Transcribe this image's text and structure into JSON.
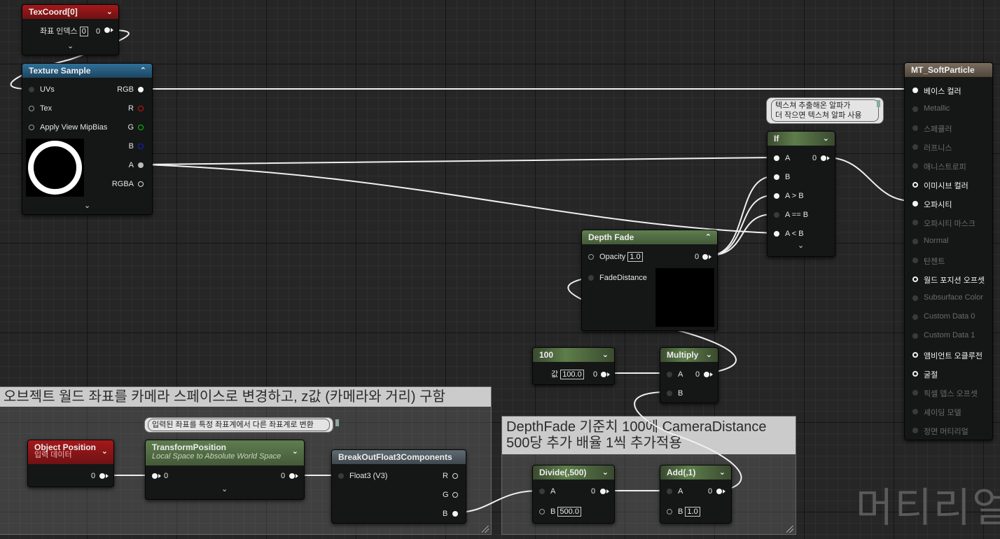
{
  "comments": {
    "c1": "오브젝트 월드 좌표를 카메라 스페이스로 변경하고, z값 (카메라와 거리) 구함",
    "c2_line1": "DepthFade 기준치 100에 CameraDistance",
    "c2_line2": "500당 추가 배율 1씩 추가적용"
  },
  "bubbles": {
    "transform": "입력된 좌표를 특정 좌표계에서 다른 좌표계로 변환",
    "if_line1": "텍스쳐 추출해온 알파가",
    "if_line2": "더 작으면 텍스쳐 알파 사용"
  },
  "nodes": {
    "texcoord": {
      "title": "TexCoord[0]",
      "param_label": "좌표 인덱스",
      "param_value": "0",
      "out": "0"
    },
    "texsample": {
      "title": "Texture Sample",
      "inputs": [
        "UVs",
        "Tex",
        "Apply View MipBias"
      ],
      "outputs": [
        "RGB",
        "R",
        "G",
        "B",
        "A",
        "RGBA"
      ]
    },
    "ifnode": {
      "title": "If",
      "out": "0",
      "inputs": [
        "A",
        "B",
        "A > B",
        "A == B",
        "A < B"
      ]
    },
    "depthfade": {
      "title": "Depth Fade",
      "opacity_label": "Opacity",
      "opacity_value": "1.0",
      "fadedist_label": "FadeDistance",
      "out": "0"
    },
    "const100": {
      "title": "100",
      "label": "값",
      "value": "100.0",
      "out": "0"
    },
    "multiply": {
      "title": "Multiply",
      "a": "A",
      "b": "B",
      "out": "0"
    },
    "objpos": {
      "title": "Object Position",
      "subtitle": "입력 데이터",
      "out": "0"
    },
    "transform": {
      "title": "TransformPosition",
      "subtitle": "Local Space to Absolute World Space",
      "in": "0",
      "out": "0"
    },
    "breakout": {
      "title": "BreakOutFloat3Components",
      "in": "Float3 (V3)",
      "outputs": [
        "R",
        "G",
        "B"
      ]
    },
    "divide": {
      "title": "Divide(,500)",
      "a": "A",
      "b": "B",
      "b_value": "500.0",
      "out": "0"
    },
    "add": {
      "title": "Add(,1)",
      "a": "A",
      "b": "B",
      "b_value": "1.0",
      "out": "0"
    }
  },
  "result": {
    "title": "MT_SoftParticle",
    "pins": [
      {
        "label": "베이스 컬러",
        "active": true
      },
      {
        "label": "Metallic",
        "active": false
      },
      {
        "label": "스페큘러",
        "active": false
      },
      {
        "label": "러프니스",
        "active": false
      },
      {
        "label": "애니스트로피",
        "active": false
      },
      {
        "label": "이미시브 컬러",
        "active": true
      },
      {
        "label": "오파시티",
        "active": true
      },
      {
        "label": "오파시티 마스크",
        "active": false
      },
      {
        "label": "Normal",
        "active": false
      },
      {
        "label": "탄젠트",
        "active": false
      },
      {
        "label": "월드 포지션 오프셋",
        "active": true
      },
      {
        "label": "Subsurface Color",
        "active": false
      },
      {
        "label": "Custom Data 0",
        "active": false
      },
      {
        "label": "Custom Data 1",
        "active": false
      },
      {
        "label": "앰비언트 오클루전",
        "active": true
      },
      {
        "label": "굴절",
        "active": true
      },
      {
        "label": "픽셀 뎁스 오프셋",
        "active": false
      },
      {
        "label": "셰이딩 모델",
        "active": false
      },
      {
        "label": "정면 머티리얼",
        "active": false
      }
    ]
  },
  "watermark": "머티리얼",
  "colors": {
    "wire": "#f0f0f0",
    "pin_r": "#d01010",
    "pin_g": "#10c010",
    "pin_b": "#1020d0"
  }
}
